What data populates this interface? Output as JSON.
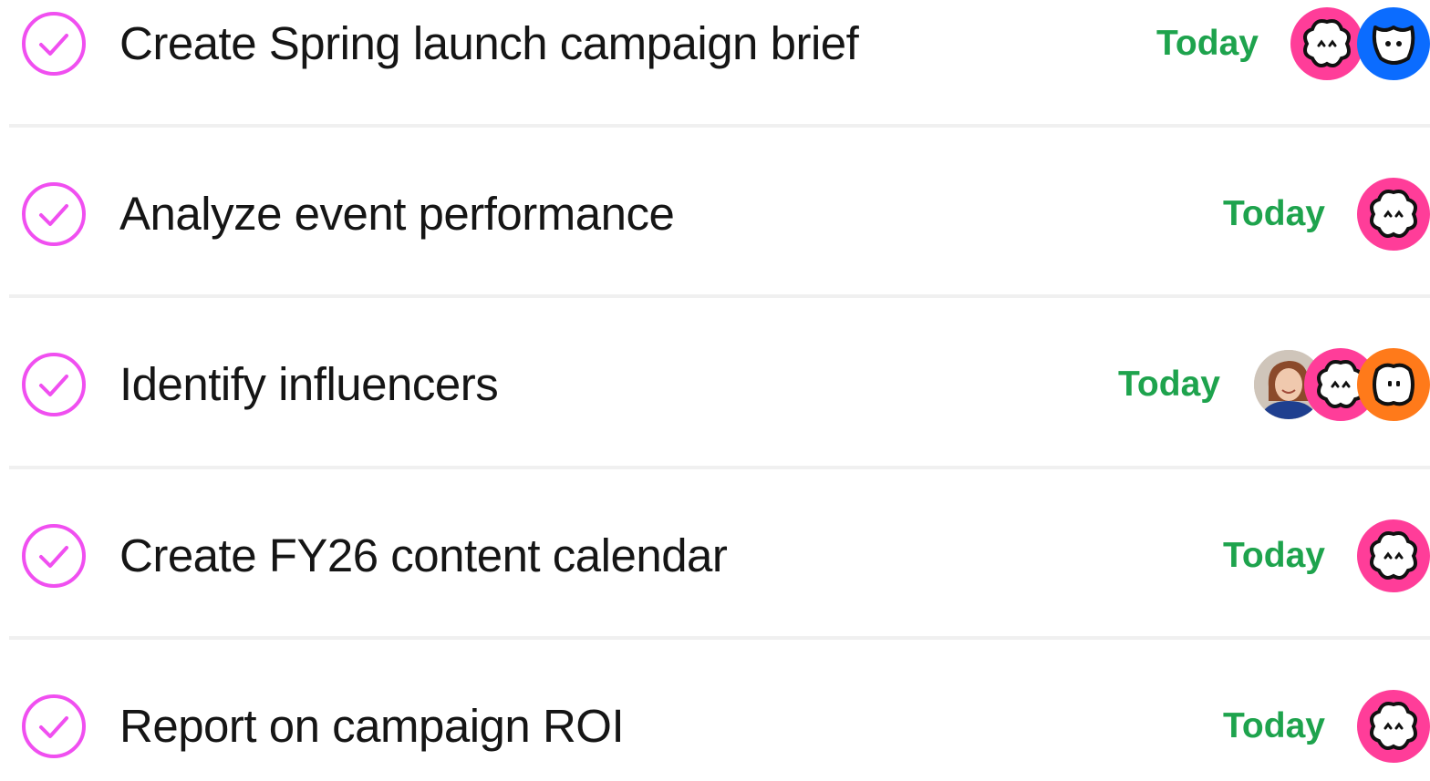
{
  "tasks": [
    {
      "title": "Create Spring launch campaign brief",
      "due": "Today",
      "assignees": [
        "pink-avatar",
        "blue-avatar"
      ]
    },
    {
      "title": "Analyze event performance",
      "due": "Today",
      "assignees": [
        "pink-avatar"
      ]
    },
    {
      "title": "Identify influencers",
      "due": "Today",
      "assignees": [
        "photo-avatar",
        "pink-avatar",
        "orange-avatar"
      ]
    },
    {
      "title": "Create FY26 content calendar",
      "due": "Today",
      "assignees": [
        "pink-avatar"
      ]
    },
    {
      "title": "Report on campaign ROI",
      "due": "Today",
      "assignees": [
        "pink-avatar"
      ]
    }
  ],
  "colors": {
    "check_accent": "#f04ff0",
    "due_today": "#1ea34d",
    "avatar_pink": "#ff3d99",
    "avatar_blue": "#0b6cff",
    "avatar_orange": "#ff7a1a"
  }
}
